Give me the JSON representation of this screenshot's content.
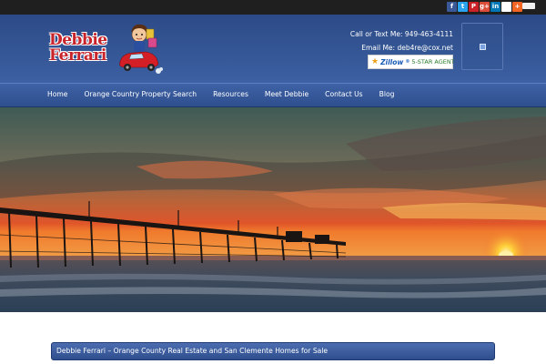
{
  "social": {
    "icons": [
      {
        "name": "facebook-icon",
        "glyph": "f",
        "cls": "fb"
      },
      {
        "name": "twitter-icon",
        "glyph": "t",
        "cls": "tw"
      },
      {
        "name": "pinterest-icon",
        "glyph": "P",
        "cls": "pi"
      },
      {
        "name": "google-plus-icon",
        "glyph": "g+",
        "cls": "gp"
      },
      {
        "name": "linkedin-icon",
        "glyph": "in",
        "cls": "li"
      },
      {
        "name": "delicious-icon",
        "glyph": "",
        "cls": "dl"
      },
      {
        "name": "share-plus-icon",
        "glyph": "+",
        "cls": "sp"
      }
    ]
  },
  "header": {
    "logo_line1": "Debbie",
    "logo_line2": "Ferrari",
    "phone_line": "Call or Text Me: 949-463-4111",
    "email_line": "Email Me: deb4re@cox.net",
    "zillow_brand": "Zillow",
    "zillow_badge": "5-STAR AGENT"
  },
  "nav": {
    "items": [
      {
        "label": "Home",
        "name": "nav-home"
      },
      {
        "label": "Orange Country Property Search",
        "name": "nav-property-search"
      },
      {
        "label": "Resources",
        "name": "nav-resources"
      },
      {
        "label": "Meet Debbie",
        "name": "nav-meet-debbie"
      },
      {
        "label": "Contact Us",
        "name": "nav-contact-us"
      },
      {
        "label": "Blog",
        "name": "nav-blog"
      }
    ]
  },
  "content": {
    "title": "Debbie Ferrari – Orange County Real Estate and San Clemente Homes for Sale"
  },
  "colors": {
    "header_blue": "#345594",
    "logo_red": "#c8242b",
    "topbar": "#1f1f1f"
  }
}
